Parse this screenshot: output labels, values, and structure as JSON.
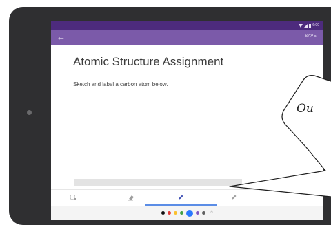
{
  "status_bar": {
    "time": "6:00",
    "icons": [
      "wifi-icon",
      "signal-icon",
      "battery-icon"
    ]
  },
  "app_bar": {
    "back_icon": "arrow-left-icon",
    "save_label": "SAVE",
    "background": "#7b5aa9",
    "status_background": "#4d2b7d"
  },
  "document": {
    "title": "Atomic Structure Assignment",
    "instructions": "Sketch and label a carbon atom below."
  },
  "toolbar": {
    "tools": [
      "selection-tool-icon",
      "eraser-icon",
      "pen-icon",
      "highlighter-icon"
    ],
    "active_tool": "pen-icon",
    "accent": "#5b8de6"
  },
  "palette": {
    "colors": [
      "#111111",
      "#e53935",
      "#fbc02d",
      "#43a047",
      "#2979ff",
      "#7e57c2",
      "#616161"
    ],
    "selected_color": "#2979ff",
    "expand_icon": "chevron-up-icon"
  },
  "callout": {
    "text": "Ou"
  }
}
